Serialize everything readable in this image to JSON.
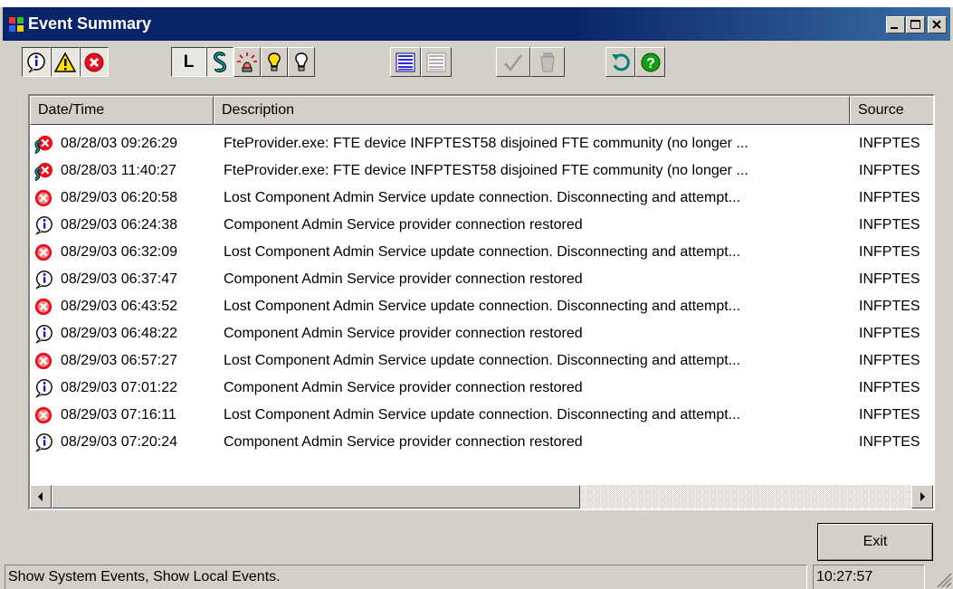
{
  "window": {
    "title": "Event Summary"
  },
  "toolbar": {
    "filter_local_label": "L",
    "filter_system_label": "S"
  },
  "columns": [
    "Date/Time",
    "Description",
    "Source"
  ],
  "rows": [
    {
      "type": "system-error",
      "datetime": "08/28/03 09:26:29",
      "description": "FteProvider.exe: FTE device INFPTEST58 disjoined FTE community (no longer ...",
      "source": "INFPTES"
    },
    {
      "type": "system-error",
      "datetime": "08/28/03 11:40:27",
      "description": "FteProvider.exe: FTE device INFPTEST58 disjoined FTE community (no longer ...",
      "source": "INFPTES"
    },
    {
      "type": "error",
      "datetime": "08/29/03 06:20:58",
      "description": "Lost Component Admin Service update connection.  Disconnecting and attempt...",
      "source": "INFPTES"
    },
    {
      "type": "info",
      "datetime": "08/29/03 06:24:38",
      "description": "Component Admin Service provider connection restored",
      "source": "INFPTES"
    },
    {
      "type": "error",
      "datetime": "08/29/03 06:32:09",
      "description": "Lost Component Admin Service update connection.  Disconnecting and attempt...",
      "source": "INFPTES"
    },
    {
      "type": "info",
      "datetime": "08/29/03 06:37:47",
      "description": "Component Admin Service provider connection restored",
      "source": "INFPTES"
    },
    {
      "type": "error",
      "datetime": "08/29/03 06:43:52",
      "description": "Lost Component Admin Service update connection.  Disconnecting and attempt...",
      "source": "INFPTES"
    },
    {
      "type": "info",
      "datetime": "08/29/03 06:48:22",
      "description": "Component Admin Service provider connection restored",
      "source": "INFPTES"
    },
    {
      "type": "error",
      "datetime": "08/29/03 06:57:27",
      "description": "Lost Component Admin Service update connection.  Disconnecting and attempt...",
      "source": "INFPTES"
    },
    {
      "type": "info",
      "datetime": "08/29/03 07:01:22",
      "description": "Component Admin Service provider connection restored",
      "source": "INFPTES"
    },
    {
      "type": "error",
      "datetime": "08/29/03 07:16:11",
      "description": "Lost Component Admin Service update connection.  Disconnecting and attempt...",
      "source": "INFPTES"
    },
    {
      "type": "info",
      "datetime": "08/29/03 07:20:24",
      "description": "Component Admin Service provider connection restored",
      "source": "INFPTES"
    }
  ],
  "buttons": {
    "exit": "Exit"
  },
  "status": {
    "message": "Show System Events, Show Local Events.",
    "time": "10:27:57"
  },
  "colors": {
    "titlebar": "#0a246a",
    "error": "#e8101a",
    "info": "#1010c0",
    "warning": "#ffe000",
    "system_link": "#00a0a0"
  }
}
